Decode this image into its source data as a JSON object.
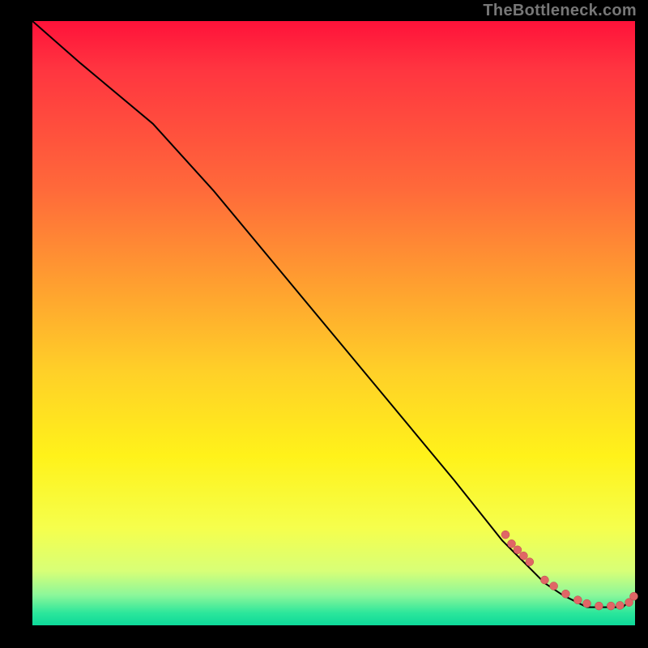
{
  "attribution": "TheBottleneck.com",
  "colors": {
    "marker_fill": "#e06666",
    "marker_stroke": "#b94a4a",
    "curve_stroke": "#000000",
    "frame_bg": "#000000"
  },
  "chart_data": {
    "type": "line",
    "title": "",
    "xlabel": "",
    "ylabel": "",
    "xlim": [
      0,
      100
    ],
    "ylim": [
      0,
      100
    ],
    "series": [
      {
        "name": "bottleneck-curve",
        "x": [
          0,
          8,
          20,
          30,
          40,
          50,
          60,
          70,
          78,
          82,
          85,
          88,
          90,
          92,
          94,
          96,
          98,
          99,
          100
        ],
        "values": [
          100,
          93,
          83,
          72,
          60,
          48,
          36,
          24,
          14,
          10,
          7,
          5,
          4,
          3,
          3,
          3,
          3,
          4,
          5
        ]
      }
    ],
    "markers": {
      "name": "highlight-points",
      "x": [
        78.5,
        79.5,
        80.5,
        81.5,
        82.5,
        85.0,
        86.5,
        88.5,
        90.5,
        92.0,
        94.0,
        96.0,
        97.5,
        99.0,
        99.8
      ],
      "values": [
        15.0,
        13.5,
        12.5,
        11.5,
        10.5,
        7.5,
        6.5,
        5.2,
        4.2,
        3.6,
        3.2,
        3.2,
        3.3,
        3.8,
        4.8
      ]
    }
  }
}
